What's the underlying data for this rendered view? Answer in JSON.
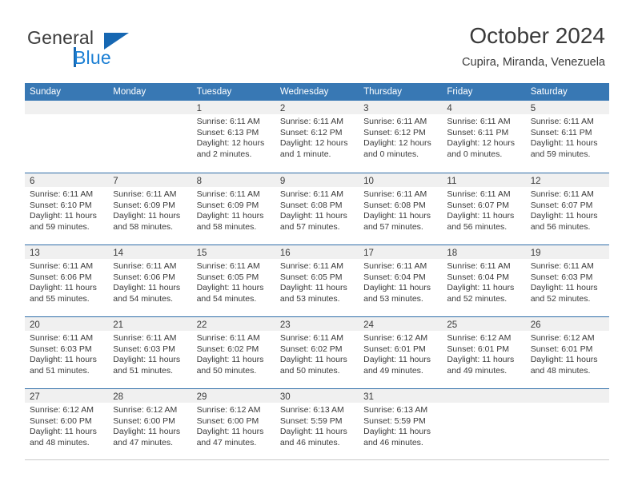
{
  "logo": {
    "word_one": "General",
    "word_two": "Blue",
    "triangle_icon": "blue-triangle-icon",
    "accent_color": "#1667b2"
  },
  "header": {
    "title": "October 2024",
    "subtitle": "Cupira, Miranda, Venezuela"
  },
  "theme": {
    "header_bar_color": "#3878b4",
    "row_divider_color": "#2f6da8",
    "day_strip_color": "#f0f0f0",
    "text_color": "#3a3a3a"
  },
  "weekdays": [
    "Sunday",
    "Monday",
    "Tuesday",
    "Wednesday",
    "Thursday",
    "Friday",
    "Saturday"
  ],
  "weeks": [
    [
      {
        "day": "",
        "empty": true
      },
      {
        "day": "",
        "empty": true
      },
      {
        "day": "1",
        "sunrise": "Sunrise: 6:11 AM",
        "sunset": "Sunset: 6:13 PM",
        "daylight1": "Daylight: 12 hours",
        "daylight2": "and 2 minutes."
      },
      {
        "day": "2",
        "sunrise": "Sunrise: 6:11 AM",
        "sunset": "Sunset: 6:12 PM",
        "daylight1": "Daylight: 12 hours",
        "daylight2": "and 1 minute."
      },
      {
        "day": "3",
        "sunrise": "Sunrise: 6:11 AM",
        "sunset": "Sunset: 6:12 PM",
        "daylight1": "Daylight: 12 hours",
        "daylight2": "and 0 minutes."
      },
      {
        "day": "4",
        "sunrise": "Sunrise: 6:11 AM",
        "sunset": "Sunset: 6:11 PM",
        "daylight1": "Daylight: 12 hours",
        "daylight2": "and 0 minutes."
      },
      {
        "day": "5",
        "sunrise": "Sunrise: 6:11 AM",
        "sunset": "Sunset: 6:11 PM",
        "daylight1": "Daylight: 11 hours",
        "daylight2": "and 59 minutes."
      }
    ],
    [
      {
        "day": "6",
        "sunrise": "Sunrise: 6:11 AM",
        "sunset": "Sunset: 6:10 PM",
        "daylight1": "Daylight: 11 hours",
        "daylight2": "and 59 minutes."
      },
      {
        "day": "7",
        "sunrise": "Sunrise: 6:11 AM",
        "sunset": "Sunset: 6:09 PM",
        "daylight1": "Daylight: 11 hours",
        "daylight2": "and 58 minutes."
      },
      {
        "day": "8",
        "sunrise": "Sunrise: 6:11 AM",
        "sunset": "Sunset: 6:09 PM",
        "daylight1": "Daylight: 11 hours",
        "daylight2": "and 58 minutes."
      },
      {
        "day": "9",
        "sunrise": "Sunrise: 6:11 AM",
        "sunset": "Sunset: 6:08 PM",
        "daylight1": "Daylight: 11 hours",
        "daylight2": "and 57 minutes."
      },
      {
        "day": "10",
        "sunrise": "Sunrise: 6:11 AM",
        "sunset": "Sunset: 6:08 PM",
        "daylight1": "Daylight: 11 hours",
        "daylight2": "and 57 minutes."
      },
      {
        "day": "11",
        "sunrise": "Sunrise: 6:11 AM",
        "sunset": "Sunset: 6:07 PM",
        "daylight1": "Daylight: 11 hours",
        "daylight2": "and 56 minutes."
      },
      {
        "day": "12",
        "sunrise": "Sunrise: 6:11 AM",
        "sunset": "Sunset: 6:07 PM",
        "daylight1": "Daylight: 11 hours",
        "daylight2": "and 56 minutes."
      }
    ],
    [
      {
        "day": "13",
        "sunrise": "Sunrise: 6:11 AM",
        "sunset": "Sunset: 6:06 PM",
        "daylight1": "Daylight: 11 hours",
        "daylight2": "and 55 minutes."
      },
      {
        "day": "14",
        "sunrise": "Sunrise: 6:11 AM",
        "sunset": "Sunset: 6:06 PM",
        "daylight1": "Daylight: 11 hours",
        "daylight2": "and 54 minutes."
      },
      {
        "day": "15",
        "sunrise": "Sunrise: 6:11 AM",
        "sunset": "Sunset: 6:05 PM",
        "daylight1": "Daylight: 11 hours",
        "daylight2": "and 54 minutes."
      },
      {
        "day": "16",
        "sunrise": "Sunrise: 6:11 AM",
        "sunset": "Sunset: 6:05 PM",
        "daylight1": "Daylight: 11 hours",
        "daylight2": "and 53 minutes."
      },
      {
        "day": "17",
        "sunrise": "Sunrise: 6:11 AM",
        "sunset": "Sunset: 6:04 PM",
        "daylight1": "Daylight: 11 hours",
        "daylight2": "and 53 minutes."
      },
      {
        "day": "18",
        "sunrise": "Sunrise: 6:11 AM",
        "sunset": "Sunset: 6:04 PM",
        "daylight1": "Daylight: 11 hours",
        "daylight2": "and 52 minutes."
      },
      {
        "day": "19",
        "sunrise": "Sunrise: 6:11 AM",
        "sunset": "Sunset: 6:03 PM",
        "daylight1": "Daylight: 11 hours",
        "daylight2": "and 52 minutes."
      }
    ],
    [
      {
        "day": "20",
        "sunrise": "Sunrise: 6:11 AM",
        "sunset": "Sunset: 6:03 PM",
        "daylight1": "Daylight: 11 hours",
        "daylight2": "and 51 minutes."
      },
      {
        "day": "21",
        "sunrise": "Sunrise: 6:11 AM",
        "sunset": "Sunset: 6:03 PM",
        "daylight1": "Daylight: 11 hours",
        "daylight2": "and 51 minutes."
      },
      {
        "day": "22",
        "sunrise": "Sunrise: 6:11 AM",
        "sunset": "Sunset: 6:02 PM",
        "daylight1": "Daylight: 11 hours",
        "daylight2": "and 50 minutes."
      },
      {
        "day": "23",
        "sunrise": "Sunrise: 6:11 AM",
        "sunset": "Sunset: 6:02 PM",
        "daylight1": "Daylight: 11 hours",
        "daylight2": "and 50 minutes."
      },
      {
        "day": "24",
        "sunrise": "Sunrise: 6:12 AM",
        "sunset": "Sunset: 6:01 PM",
        "daylight1": "Daylight: 11 hours",
        "daylight2": "and 49 minutes."
      },
      {
        "day": "25",
        "sunrise": "Sunrise: 6:12 AM",
        "sunset": "Sunset: 6:01 PM",
        "daylight1": "Daylight: 11 hours",
        "daylight2": "and 49 minutes."
      },
      {
        "day": "26",
        "sunrise": "Sunrise: 6:12 AM",
        "sunset": "Sunset: 6:01 PM",
        "daylight1": "Daylight: 11 hours",
        "daylight2": "and 48 minutes."
      }
    ],
    [
      {
        "day": "27",
        "sunrise": "Sunrise: 6:12 AM",
        "sunset": "Sunset: 6:00 PM",
        "daylight1": "Daylight: 11 hours",
        "daylight2": "and 48 minutes."
      },
      {
        "day": "28",
        "sunrise": "Sunrise: 6:12 AM",
        "sunset": "Sunset: 6:00 PM",
        "daylight1": "Daylight: 11 hours",
        "daylight2": "and 47 minutes."
      },
      {
        "day": "29",
        "sunrise": "Sunrise: 6:12 AM",
        "sunset": "Sunset: 6:00 PM",
        "daylight1": "Daylight: 11 hours",
        "daylight2": "and 47 minutes."
      },
      {
        "day": "30",
        "sunrise": "Sunrise: 6:13 AM",
        "sunset": "Sunset: 5:59 PM",
        "daylight1": "Daylight: 11 hours",
        "daylight2": "and 46 minutes."
      },
      {
        "day": "31",
        "sunrise": "Sunrise: 6:13 AM",
        "sunset": "Sunset: 5:59 PM",
        "daylight1": "Daylight: 11 hours",
        "daylight2": "and 46 minutes."
      },
      {
        "day": "",
        "empty": true
      },
      {
        "day": "",
        "empty": true
      }
    ]
  ]
}
